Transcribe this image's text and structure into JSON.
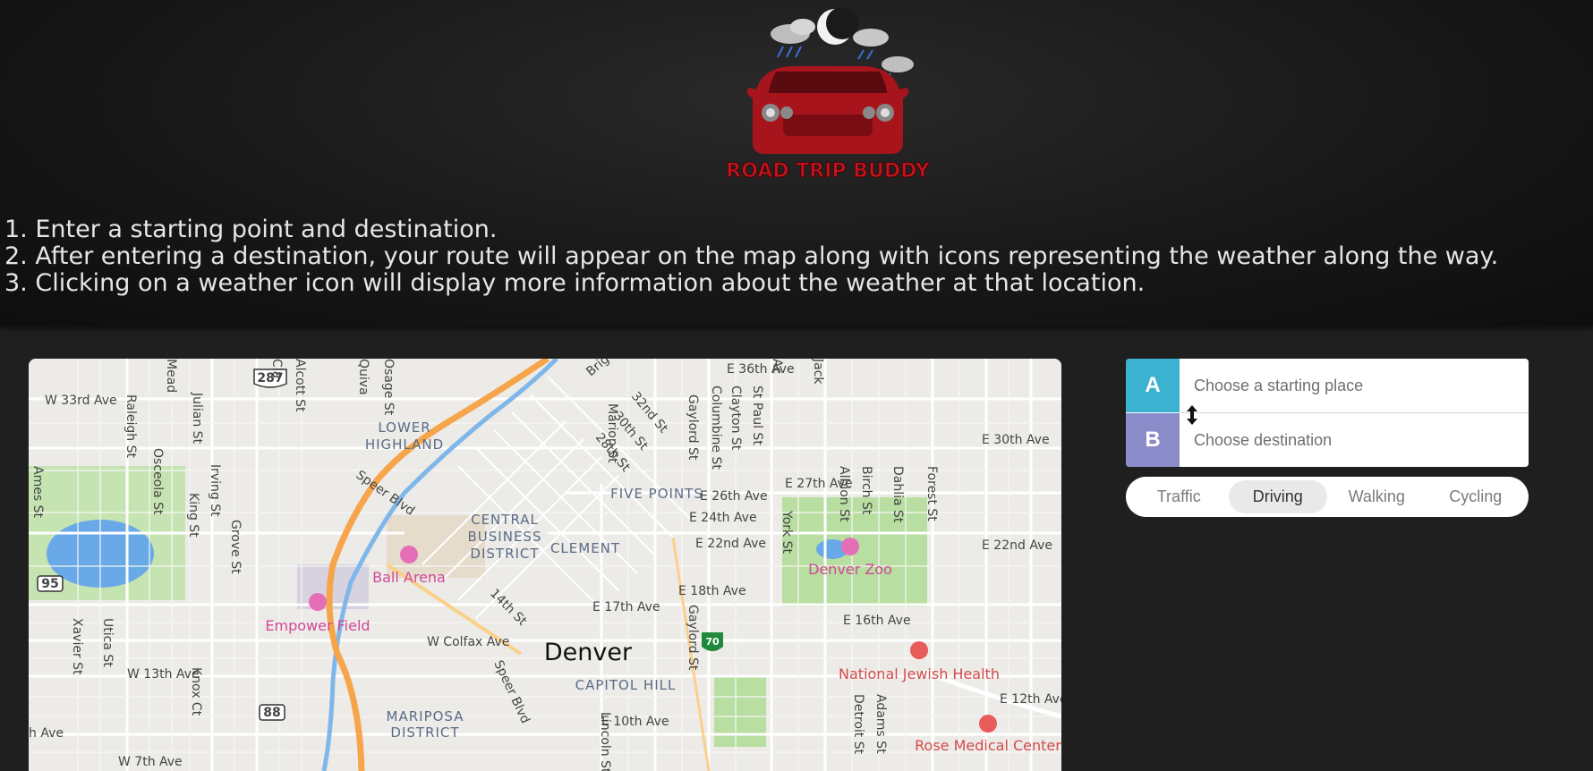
{
  "logo": {
    "text": "ROAD TRIP BUDDY"
  },
  "instructions": [
    "1. Enter a starting point and destination.",
    "2. After entering a destination, your route will appear on the map along with icons representing the weather along the way.",
    "3. Clicking on a weather icon will display more information about the weather at that location."
  ],
  "directions": {
    "origin_badge": "A",
    "destination_badge": "B",
    "origin_placeholder": "Choose a starting place",
    "destination_placeholder": "Choose destination",
    "profiles": [
      {
        "label": "Traffic",
        "active": false
      },
      {
        "label": "Driving",
        "active": true
      },
      {
        "label": "Walking",
        "active": false
      },
      {
        "label": "Cycling",
        "active": false
      }
    ]
  },
  "map": {
    "city_label": "Denver",
    "shields": {
      "us_287": "287",
      "co_95": "95",
      "co_88": "88",
      "i_70": "70"
    },
    "districts": {
      "lower_highland_1": "LOWER",
      "lower_highland_2": "HIGHLAND",
      "cbd_1": "CENTRAL",
      "cbd_2": "BUSINESS",
      "cbd_3": "DISTRICT",
      "clement": "CLEMENT",
      "five_points": "FIVE POINTS",
      "capitol_hill": "CAPITOL HILL",
      "mariposa_1": "MARIPOSA",
      "mariposa_2": "DISTRICT"
    },
    "pois": {
      "ball_arena": "Ball Arena",
      "empower_field": "Empower Field",
      "denver_zoo": "Denver Zoo",
      "national_jewish": "National Jewish Health",
      "rose_medical": "Rose Medical Center"
    },
    "streets": {
      "w33rd": "W 33rd Ave",
      "e36th": "E 36th Ave",
      "e30th": "E 30th Ave",
      "e27th": "E 27th Ave",
      "e26th": "E 26th Ave",
      "e24th": "E 24th Ave",
      "e22nd": "E 22nd Ave",
      "e22nd_east": "E 22nd Ave",
      "e18th": "E 18th Ave",
      "e17th": "E 17th Ave",
      "e16th": "E 16th Ave",
      "wcolfax": "W Colfax Ave",
      "w13th": "W 13th Ave",
      "e12th": "E 12th Ave",
      "e10th": "E 10th Ave",
      "w7th": "W 7th Ave",
      "h_ave": "h Ave",
      "speer1": "Speer Blvd",
      "speer2": "Speer Blvd",
      "s14th": "14th St",
      "s32nd": "32nd St",
      "s30th": "30th St",
      "s28th": "28th St",
      "ames": "Ames St",
      "raleigh": "Raleigh St",
      "osceola": "Osceola St",
      "julian": "Julian St",
      "irving": "Irving St",
      "king": "King St",
      "grove": "Grove St",
      "xavier": "Xavier St",
      "utica": "Utica St",
      "knox": "Knox Ct",
      "alcott": "Alcott St",
      "marion": "Marion St",
      "gaylord": "Gaylord St",
      "gaylord2": "Gaylord St",
      "columbine": "Columbine St",
      "clayton": "Clayton St",
      "stpaul": "St Paul St",
      "york": "York St",
      "albion": "Albion St",
      "birch": "Birch St",
      "dahlia": "Dahlia St",
      "forest": "Forest St",
      "detroit": "Detroit St",
      "adams": "Adams St",
      "lincoln": "Lincoln St",
      "mead": "Mead",
      "quiva": "Quiva",
      "osage": "Osage St",
      "brig": "Brig",
      "cla": "Cla",
      "ac": "Ac",
      "jack": "Jack"
    }
  }
}
